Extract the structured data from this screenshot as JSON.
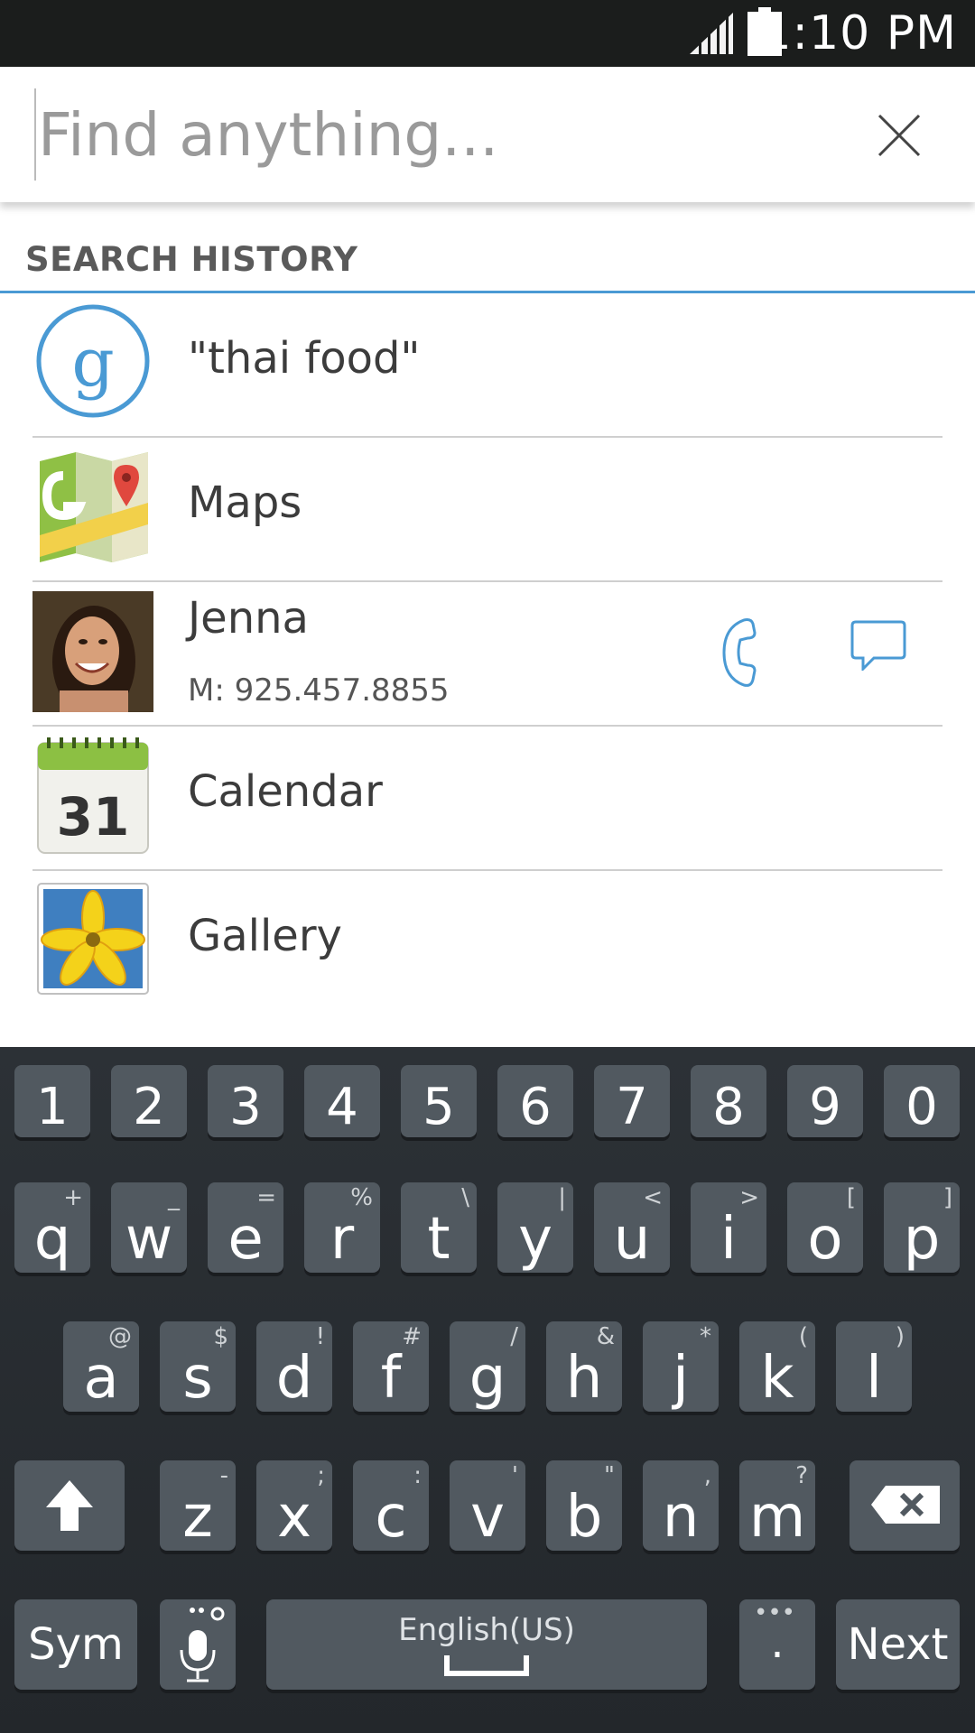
{
  "status_bar": {
    "time": "1:10 PM"
  },
  "search": {
    "placeholder": "Find anything...",
    "value": ""
  },
  "section": {
    "title": "SEARCH HISTORY"
  },
  "results": [
    {
      "type": "web",
      "title": "\"thai food\"",
      "icon": "google-search-icon"
    },
    {
      "type": "app",
      "title": "Maps",
      "icon": "maps-icon"
    },
    {
      "type": "contact",
      "title": "Jenna",
      "subtitle": "M: 925.457.8855",
      "icon": "contact-photo"
    },
    {
      "type": "app",
      "title": "Calendar",
      "icon": "calendar-icon",
      "calendar_day": "31"
    },
    {
      "type": "app",
      "title": "Gallery",
      "icon": "gallery-icon"
    }
  ],
  "keyboard": {
    "numbers": [
      "1",
      "2",
      "3",
      "4",
      "5",
      "6",
      "7",
      "8",
      "9",
      "0"
    ],
    "row1": [
      {
        "k": "q",
        "h": "+"
      },
      {
        "k": "w",
        "h": "_"
      },
      {
        "k": "e",
        "h": "="
      },
      {
        "k": "r",
        "h": "%"
      },
      {
        "k": "t",
        "h": "\\"
      },
      {
        "k": "y",
        "h": "|"
      },
      {
        "k": "u",
        "h": "<"
      },
      {
        "k": "i",
        "h": ">"
      },
      {
        "k": "o",
        "h": "["
      },
      {
        "k": "p",
        "h": "]"
      }
    ],
    "row2": [
      {
        "k": "a",
        "h": "@"
      },
      {
        "k": "s",
        "h": "$"
      },
      {
        "k": "d",
        "h": "!"
      },
      {
        "k": "f",
        "h": "#"
      },
      {
        "k": "g",
        "h": "/"
      },
      {
        "k": "h",
        "h": "&"
      },
      {
        "k": "j",
        "h": "*"
      },
      {
        "k": "k",
        "h": "("
      },
      {
        "k": "l",
        "h": ")"
      }
    ],
    "row3": [
      {
        "k": "z",
        "h": "-"
      },
      {
        "k": "x",
        "h": ";"
      },
      {
        "k": "c",
        "h": ":"
      },
      {
        "k": "v",
        "h": "'"
      },
      {
        "k": "b",
        "h": "\""
      },
      {
        "k": "n",
        "h": ","
      },
      {
        "k": "m",
        "h": "?"
      }
    ],
    "sym_label": "Sym",
    "space_label": "English(US)",
    "period_label": ".",
    "next_label": "Next"
  }
}
